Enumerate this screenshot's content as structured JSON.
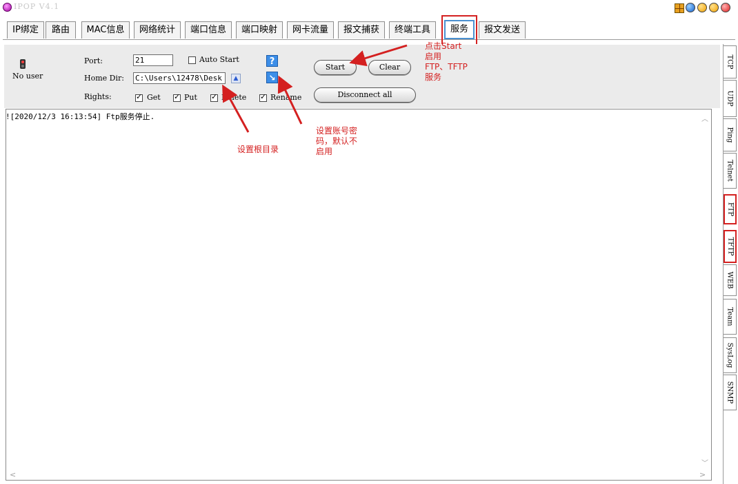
{
  "window": {
    "title": "IPOP V4.1"
  },
  "tabs": [
    {
      "label": "IP绑定"
    },
    {
      "label": "路由"
    },
    {
      "label": "MAC信息"
    },
    {
      "label": "网络统计"
    },
    {
      "label": "端口信息"
    },
    {
      "label": "端口映射"
    },
    {
      "label": "网卡流量"
    },
    {
      "label": "报文捕获"
    },
    {
      "label": "终端工具"
    },
    {
      "label": "服务",
      "active": true
    },
    {
      "label": "报文发送"
    }
  ],
  "ftp": {
    "user_status": "No user",
    "port_label": "Port:",
    "port_value": "21",
    "auto_start_label": "Auto Start",
    "auto_start_checked": false,
    "home_dir_label": "Home Dir:",
    "home_dir_value": "C:\\Users\\12478\\Desk",
    "rights_label": "Rights:",
    "rights": [
      {
        "label": "Get",
        "checked": true
      },
      {
        "label": "Put",
        "checked": true
      },
      {
        "label": "Delete",
        "checked": true
      },
      {
        "label": "Rename",
        "checked": true
      }
    ],
    "help_icon": "?",
    "start_label": "Start",
    "clear_label": "Clear",
    "disconnect_label": "Disconnect all"
  },
  "log": {
    "lines": [
      "![2020/12/3 16:13:54] Ftp服务停止."
    ]
  },
  "side_tabs": [
    {
      "label": "TCP"
    },
    {
      "label": "UDP"
    },
    {
      "label": "Ping"
    },
    {
      "label": "Telnet"
    },
    {
      "label": "FTP",
      "highlighted": true
    },
    {
      "label": "TFTP",
      "highlighted": true
    },
    {
      "label": "WEB"
    },
    {
      "label": "Team"
    },
    {
      "label": "SysLog"
    },
    {
      "label": "SNMP"
    }
  ],
  "annotations": {
    "start_note": [
      "点击Start",
      "启用",
      "FTP、TFTP",
      "服务"
    ],
    "root_note": "设置根目录",
    "account_note": [
      "设置账号密",
      "码，默认不",
      "启用"
    ]
  },
  "colors": {
    "annotation_red": "#d42020",
    "active_tab_border": "#4a90d0",
    "panel_bg": "#ebebeb",
    "icon_blue": "#3c8ee8"
  },
  "icons": {
    "app": "app-icon",
    "user_status": "traffic-light-icon",
    "help": "question-icon",
    "account": "arrow-down-right-icon",
    "dir_browse": "chevron-up-icon"
  }
}
